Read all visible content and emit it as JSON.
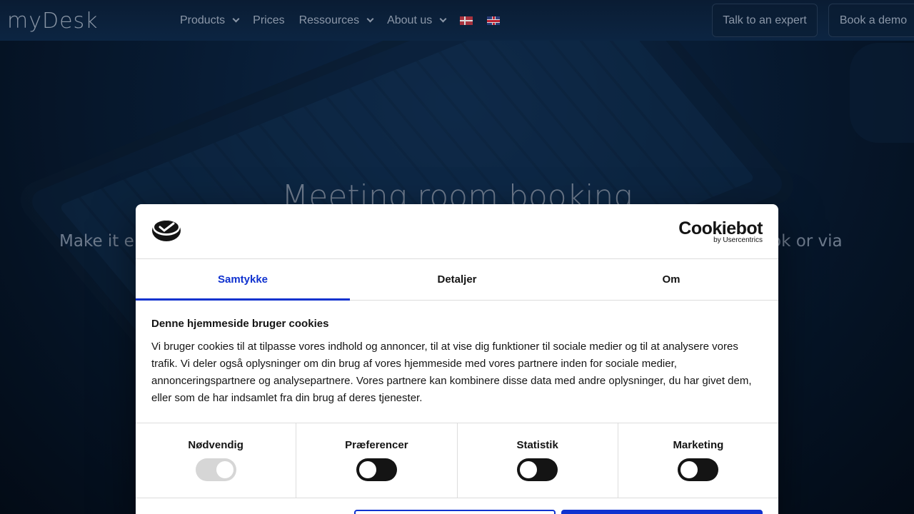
{
  "nav": {
    "logo": "myDesk",
    "items": [
      {
        "label": "Products",
        "has_dropdown": true
      },
      {
        "label": "Prices",
        "has_dropdown": false
      },
      {
        "label": "Ressources",
        "has_dropdown": true
      },
      {
        "label": "About us",
        "has_dropdown": true
      }
    ],
    "btn_expert": "Talk to an expert",
    "btn_demo": "Book a demo"
  },
  "hero": {
    "title": "Meeting room booking",
    "subtitle_start": "Make it e",
    "subtitle_end": "ok or via"
  },
  "dialog": {
    "brand_name": "Cookiebot",
    "brand_by": "by Usercentrics",
    "tabs": [
      "Samtykke",
      "Detaljer",
      "Om"
    ],
    "heading": "Denne hjemmeside bruger cookies",
    "body": "Vi bruger cookies til at tilpasse vores indhold og annoncer, til at vise dig funktioner til sociale medier og til at analysere vores trafik. Vi deler også oplysninger om din brug af vores hjemmeside med vores partnere inden for sociale medier, annonceringspartnere og analysepartnere. Vores partnere kan kombinere disse data med andre oplysninger, du har givet dem, eller som de har indsamlet fra din brug af deres tjenester.",
    "categories": [
      {
        "label": "Nødvendig",
        "on": true,
        "disabled": true
      },
      {
        "label": "Præferencer",
        "on": false
      },
      {
        "label": "Statistik",
        "on": false
      },
      {
        "label": "Marketing",
        "on": false
      }
    ]
  },
  "colors": {
    "accent": "#1032cf",
    "text": "#141414"
  }
}
